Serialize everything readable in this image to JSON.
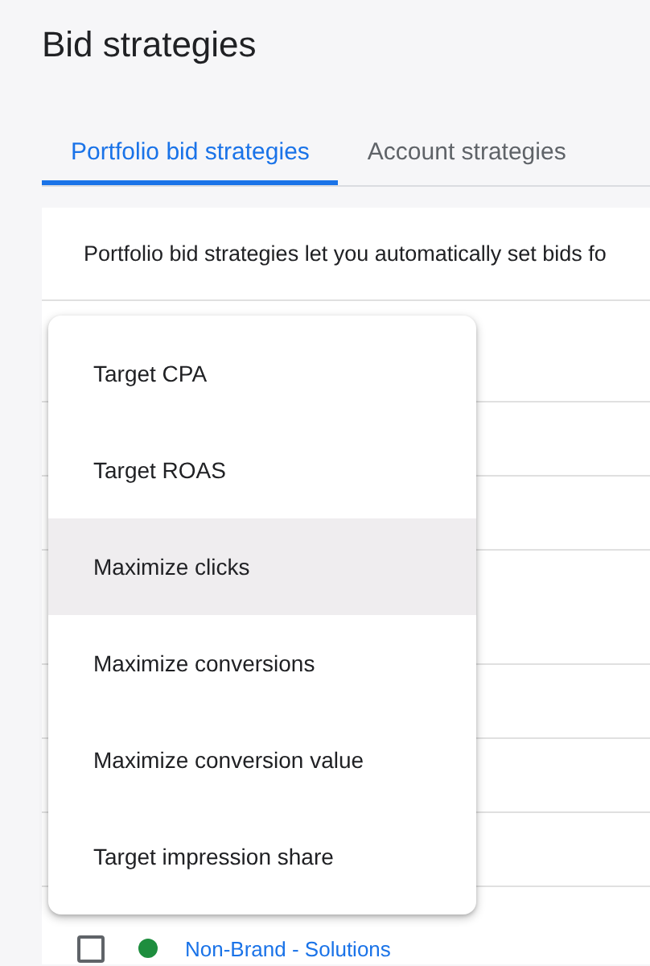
{
  "page": {
    "title": "Bid strategies"
  },
  "tabs": [
    {
      "label": "Portfolio bid strategies",
      "selected": true
    },
    {
      "label": "Account strategies",
      "selected": false
    }
  ],
  "description": "Portfolio bid strategies let you automatically set bids fo",
  "table": {
    "visible_row": {
      "checked": false,
      "color": "#1e8e3e",
      "name": "Non-Brand - Solutions"
    }
  },
  "menu": {
    "items": [
      {
        "label": "Target CPA",
        "selected": false
      },
      {
        "label": "Target ROAS",
        "selected": false
      },
      {
        "label": "Maximize clicks",
        "selected": true
      },
      {
        "label": "Maximize conversions",
        "selected": false
      },
      {
        "label": "Maximize conversion value",
        "selected": false
      },
      {
        "label": "Target impression share",
        "selected": false
      }
    ]
  }
}
